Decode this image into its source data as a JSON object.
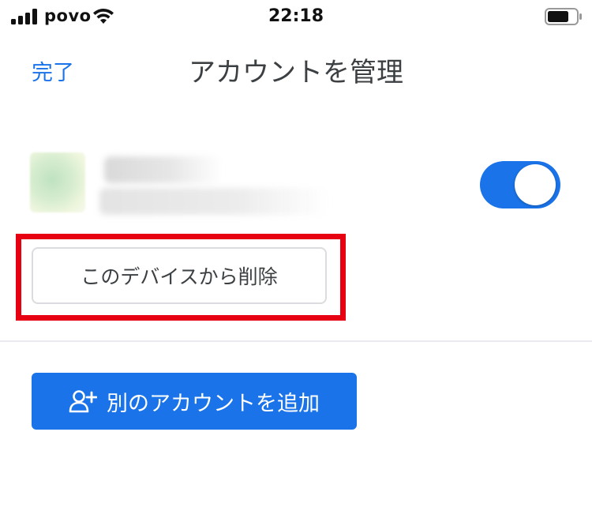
{
  "status_bar": {
    "carrier": "povo",
    "time": "22:18"
  },
  "nav": {
    "done_label": "完了",
    "title": "アカウントを管理"
  },
  "account": {
    "toggle_on": true
  },
  "actions": {
    "remove_label": "このデバイスから削除",
    "add_account_label": "別のアカウントを追加"
  },
  "colors": {
    "accent": "#1a73e8",
    "highlight": "#e60012"
  },
  "icons": {
    "add_person": "person-add-icon",
    "signal": "cellular-signal-icon",
    "wifi": "wifi-icon",
    "battery": "battery-icon"
  }
}
